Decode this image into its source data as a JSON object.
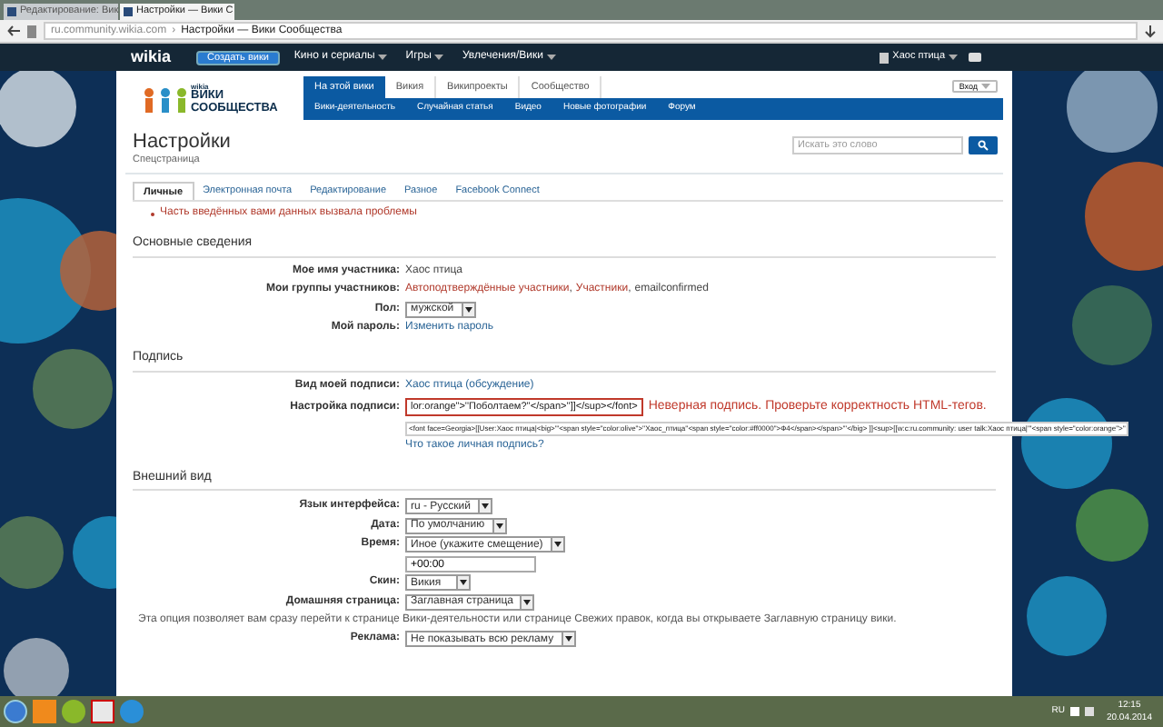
{
  "browser": {
    "tabs": [
      {
        "title": "Редактирование: Вик",
        "selected": false
      },
      {
        "title": "Настройки — Вики С",
        "selected": true
      }
    ],
    "address": {
      "url": "ru.community.wikia.com",
      "separator": "›",
      "page_title": "Настройки — Вики Сообщества"
    }
  },
  "wikia_bar": {
    "logo": "wikia",
    "create_button": "Создать вики",
    "menu": [
      "Кино и сериалы",
      "Игры",
      "Увлечения/Вики"
    ],
    "user": "Хаос птица"
  },
  "wiki": {
    "logo_small": "wikia",
    "logo_title": "ВИКИ СООБЩЕСТВА",
    "nav_tabs": [
      {
        "label": "На этой вики",
        "selected": true
      },
      {
        "label": "Викия",
        "selected": false
      },
      {
        "label": "Википроекты",
        "selected": false
      },
      {
        "label": "Сообщество",
        "selected": false
      }
    ],
    "subnav": [
      "Вики-деятельность",
      "Случайная статья",
      "Видео",
      "Новые фотографии",
      "Форум"
    ],
    "login": "Вход"
  },
  "page": {
    "title": "Настройки",
    "subtitle": "Спецстраница",
    "search": {
      "placeholder": "Искать это слово"
    },
    "tabs": [
      {
        "label": "Личные",
        "selected": true
      },
      {
        "label": "Электронная почта",
        "selected": false
      },
      {
        "label": "Редактирование",
        "selected": false
      },
      {
        "label": "Разное",
        "selected": false
      },
      {
        "label": "Facebook Connect",
        "selected": false
      }
    ],
    "error": "Часть введённых вами данных вызвала проблемы"
  },
  "sections": [
    {
      "title": "Основные сведения",
      "rows": [
        {
          "kind": "text",
          "label": "Мое имя участника:",
          "value": "Хаос птица"
        },
        {
          "kind": "groups",
          "label": "Мои группы участников:",
          "links": [
            "Автоподтверждённые участники",
            "Участники"
          ],
          "separator": ",",
          "rest": "emailconfirmed"
        },
        {
          "kind": "select",
          "label": "Пол:",
          "value": "мужской"
        },
        {
          "kind": "link",
          "label": "Мой пароль:",
          "value": "Изменить пароль"
        }
      ]
    },
    {
      "title": "Подпись",
      "rows": [
        {
          "kind": "link",
          "label": "Вид моей подписи:",
          "value": "Хаос птица (обсуждение)"
        },
        {
          "kind": "signature",
          "label": "Настройка подписи:",
          "value": "lor:orange\">''Поболтаем?''</span>'']]</sup></font>",
          "error": "Неверная подпись. Проверьте корректность HTML-тегов.",
          "preview": "<font face=Georgia>[[User:Хаос птица|<big>'''<span style=\"color:olive\">''Хаос_птица''<span style=\"color:#ff0000\">Ф4</span></span>'''</big> ]]<sup>[[w:c:ru.community: user talk:Хаос птица|'''<span style=\"color:orange\">''",
          "help": "Что такое личная подпись?"
        }
      ]
    },
    {
      "title": "Внешний вид",
      "rows": [
        {
          "kind": "select",
          "label": "Язык интерфейса:",
          "value": "ru - Русский"
        },
        {
          "kind": "select",
          "label": "Дата:",
          "value": "По умолчанию"
        },
        {
          "kind": "select",
          "label": "Время:",
          "value": "Иное (укажите смещение)",
          "extra": "+00:00"
        },
        {
          "kind": "select",
          "label": "Скин:",
          "value": "Викия"
        },
        {
          "kind": "select",
          "label": "Домашняя страница:",
          "value": "Заглавная страница"
        },
        {
          "kind": "note",
          "value": "Эта опция позволяет вам сразу перейти к странице Вики-деятельности или странице Свежих правок, когда вы открываете Заглавную страницу вики."
        },
        {
          "kind": "select",
          "label": "Реклама:",
          "value": "Не показывать всю рекламу"
        }
      ]
    }
  ],
  "taskbar": {
    "lang": "RU",
    "time": "12:15",
    "date": "20.04.2014"
  }
}
